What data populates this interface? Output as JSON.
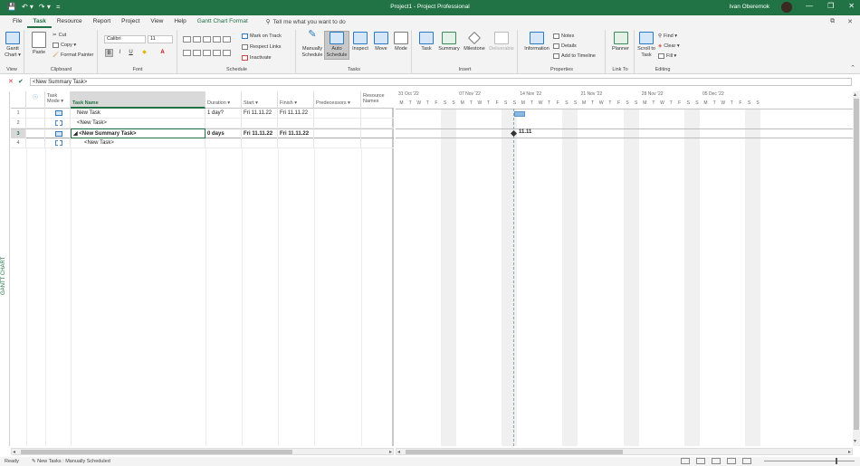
{
  "window": {
    "title": "Project1  -  Project Professional",
    "user": "Ivan Oberemok",
    "controls": [
      "—",
      "❐",
      "✕"
    ]
  },
  "qat": [
    "💾",
    "↶ ▾",
    "↷ ▾",
    "="
  ],
  "menu": {
    "tabs": [
      {
        "label": "File"
      },
      {
        "label": "Task",
        "active": true
      },
      {
        "label": "Resource"
      },
      {
        "label": "Report"
      },
      {
        "label": "Project"
      },
      {
        "label": "View"
      },
      {
        "label": "Help"
      },
      {
        "label": "Gantt Chart Format",
        "contextual": true
      }
    ],
    "tell_me": "Tell me what you want to do",
    "right_icons": [
      "⧉",
      "✕"
    ]
  },
  "ribbon": {
    "view": {
      "label": "Gantt Chart ▾",
      "group": "View"
    },
    "clipboard": {
      "paste": "Paste",
      "cut": "Cut",
      "copy": "Copy ▾",
      "format_painter": "Format Painter",
      "group": "Clipboard"
    },
    "font": {
      "family": "Calibri",
      "size": "11",
      "bold": "B",
      "italic": "I",
      "underline": "U",
      "group": "Font"
    },
    "schedule": {
      "mark_on_track": "Mark on Track",
      "respect_links": "Respect Links",
      "inactivate": "Inactivate",
      "group": "Schedule",
      "pcts": [
        "0%",
        "25%",
        "50%",
        "75%",
        "100%"
      ]
    },
    "tasks": {
      "manually": "Manually Schedule",
      "auto": "Auto Schedule",
      "inspect": "Inspect",
      "move": "Move",
      "mode": "Mode",
      "group": "Tasks"
    },
    "insert": {
      "task": "Task",
      "summary": "Summary",
      "milestone": "Milestone",
      "deliverable": "Deliverable",
      "group": "Insert"
    },
    "properties": {
      "information": "Information",
      "notes": "Notes",
      "details": "Details",
      "add_timeline": "Add to Timeline",
      "group": "Properties"
    },
    "linkto": {
      "planner": "Planner",
      "group": "Link To"
    },
    "editing": {
      "scroll": "Scroll to Task",
      "find": "Find ▾",
      "clear": "Clear ▾",
      "fill": "Fill ▾",
      "group": "Editing"
    }
  },
  "formula": {
    "cancel": "✕",
    "confirm": "✔",
    "value": "<New Summary Task>"
  },
  "sidebar_label": "GANTT CHART",
  "grid": {
    "headers": [
      "ⓘ",
      "Task Mode ▾",
      "Task Name",
      "Duration ▾",
      "Start ▾",
      "Finish ▾",
      "Predecessors ▾",
      "Resource Names"
    ],
    "rows": [
      {
        "num": "1",
        "mode": "auto",
        "name": "New Task",
        "duration": "1 day?",
        "start": "Fri 11.11.22",
        "finish": "Fri 11.11.22",
        "pred": "",
        "res": ""
      },
      {
        "num": "2",
        "mode": "manual",
        "name": "<New Task>",
        "duration": "",
        "start": "",
        "finish": "",
        "pred": "",
        "res": ""
      },
      {
        "num": "3",
        "mode": "auto",
        "name": "◢ <New Summary Task>",
        "duration": "0 days",
        "start": "Fri 11.11.22",
        "finish": "Fri 11.11.22",
        "pred": "",
        "res": ""
      },
      {
        "num": "4",
        "mode": "manual",
        "name": "<New Task>",
        "duration": "",
        "start": "",
        "finish": "",
        "pred": "",
        "res": ""
      }
    ]
  },
  "gantt": {
    "weeks": [
      "31 Oct '22",
      "07 Nov '22",
      "14 Nov '22",
      "21 Nov '22",
      "28 Nov '22",
      "05 Dec '22"
    ],
    "days": [
      "M",
      "T",
      "W",
      "T",
      "F",
      "S",
      "S"
    ],
    "milestone_label": "11.11"
  },
  "status": {
    "ready": "Ready",
    "new_tasks": "New Tasks : Manually Scheduled"
  }
}
